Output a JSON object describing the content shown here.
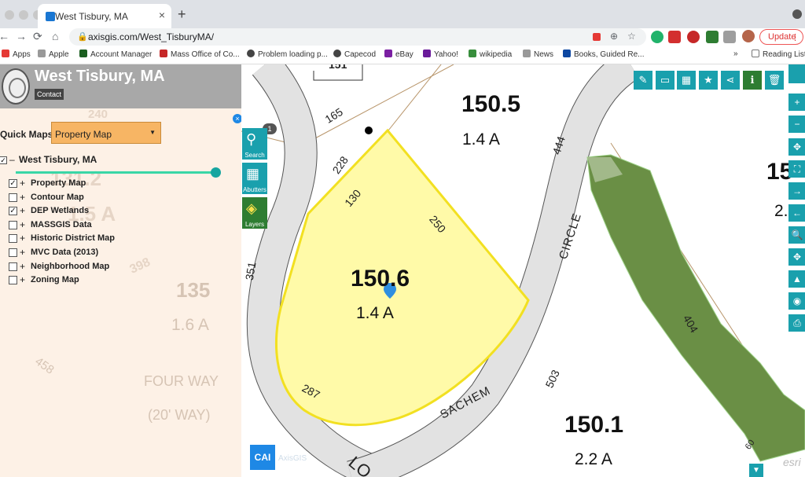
{
  "browser": {
    "tab_title": "West Tisbury, MA",
    "tab_close": "×",
    "new_tab": "+",
    "url": "axisgis.com/West_TisburyMA/",
    "update_label": "Update",
    "nav": {
      "back": "←",
      "forward": "→",
      "reload": "⟳",
      "home": "⌂",
      "lock": "🔒",
      "zoom": "⊕",
      "star": "☆",
      "menu": "⋮"
    },
    "bookmarks": [
      {
        "label": "Apps",
        "color": "#e53935"
      },
      {
        "label": "Apple",
        "color": "#777777"
      },
      {
        "label": "Account Manager",
        "color": "#1b5e20"
      },
      {
        "label": "Mass Office of Co...",
        "color": "#c62828"
      },
      {
        "label": "Problem loading p...",
        "color": "#444444"
      },
      {
        "label": "Capecod",
        "color": "#444444"
      },
      {
        "label": "eBay",
        "color": "#7b1fa2"
      },
      {
        "label": "Yahoo!",
        "color": "#6a1b9a"
      },
      {
        "label": "wikipedia",
        "color": "#388e3c"
      },
      {
        "label": "News",
        "color": "#777777"
      },
      {
        "label": "Books, Guided Re...",
        "color": "#0d47a1"
      }
    ],
    "bookmarks_more": "»",
    "reading_list": "Reading List"
  },
  "panel": {
    "title": "West Tisbury, MA",
    "contact": "Contact",
    "close": "×",
    "quick_maps_label": "Quick Maps:",
    "quick_maps_value": "Property Map",
    "quick_maps_arrow": "▼",
    "root_layer": {
      "label": "West Tisbury, MA",
      "checked": "✓",
      "toggle": "–"
    },
    "opacity_fraction": 1.0,
    "layers": [
      {
        "label": "Property Map",
        "checked": "✓"
      },
      {
        "label": "Contour Map",
        "checked": ""
      },
      {
        "label": "DEP Wetlands",
        "checked": "✓"
      },
      {
        "label": "MASSGIS Data",
        "checked": ""
      },
      {
        "label": "Historic District Map",
        "checked": ""
      },
      {
        "label": "MVC Data (2013)",
        "checked": ""
      },
      {
        "label": "Neighborhood Map",
        "checked": ""
      },
      {
        "label": "Zoning Map",
        "checked": ""
      }
    ],
    "ghost_labels": [
      "240",
      "131.2",
      "1.5 A",
      "398",
      "135",
      "1.6 A",
      "458",
      "FOUR WAY",
      "(20' WAY)"
    ]
  },
  "map": {
    "parcels": [
      {
        "id": "150.5",
        "area": "1.4 A"
      },
      {
        "id": "150.6",
        "area": "1.4 A"
      },
      {
        "id": "150.1",
        "area": "2.2 A"
      },
      {
        "id": "15",
        "area": "2."
      }
    ],
    "dimensions": [
      "165",
      "228",
      "130",
      "250",
      "444",
      "351",
      "287",
      "503",
      "404",
      "60",
      "151"
    ],
    "streets": [
      "CIRCLE",
      "SACHEM",
      "LO"
    ],
    "left_tools": [
      {
        "label": "Search",
        "icon": "search-icon"
      },
      {
        "label": "Abutters",
        "icon": "building-icon"
      },
      {
        "label": "Layers",
        "icon": "layers-icon"
      }
    ],
    "search_badge": "1",
    "top_tools": [
      "✎",
      "▭",
      "▦",
      "★",
      "⋖",
      "ℹ",
      "🗑"
    ],
    "right_tools": [
      "+",
      "−",
      "✥",
      "⛶",
      "→",
      "←",
      "🔍",
      "✥",
      "▲",
      "◉",
      "⎙"
    ],
    "logo_text": "CAI",
    "logo_caption": "AxisGIS",
    "esri": "esri",
    "down": "▼"
  },
  "colors": {
    "accent": "#1aa0ad",
    "selected_parcel": "#fffaa8",
    "selected_outline": "#f2e021",
    "wetland": "#6a8f45",
    "quick_maps": "#f7b564"
  }
}
